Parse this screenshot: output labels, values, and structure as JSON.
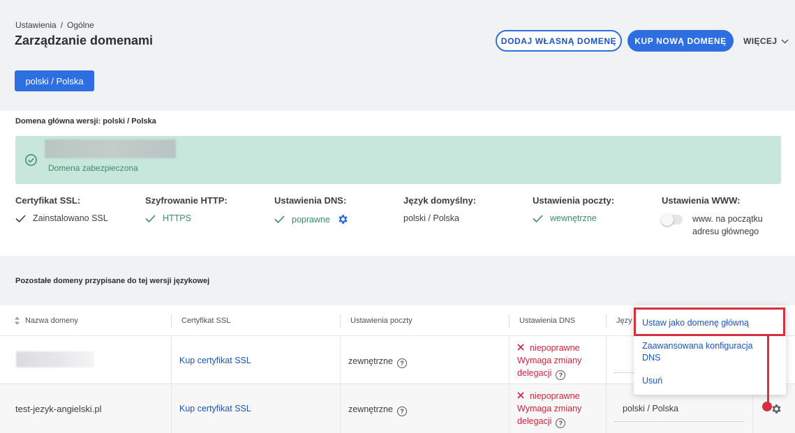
{
  "breadcrumb": {
    "parent": "Ustawienia",
    "separator": "/",
    "current": "Ogólne"
  },
  "page_title": "Zarządzanie domenami",
  "actions": {
    "add_own_domain": "DODAJ WŁASNĄ DOMENĘ",
    "buy_new_domain": "KUP NOWĄ DOMENĘ",
    "more": "WIĘCEJ"
  },
  "language_version_button": "polski / Polska",
  "main_domain": {
    "title": "Domena główna wersji: polski / Polska",
    "status": "Domena zabezpieczona",
    "columns": [
      {
        "label": "Certyfikat SSL:",
        "value": "Zainstalowano SSL"
      },
      {
        "label": "Szyfrowanie HTTP:",
        "value": "HTTPS"
      },
      {
        "label": "Ustawienia DNS:",
        "value": "poprawne"
      },
      {
        "label": "Język domyślny:",
        "value": "polski / Polska"
      },
      {
        "label": "Ustawienia poczty:",
        "value": "wewnętrzne"
      },
      {
        "label": "Ustawienia WWW:",
        "value_line1": "www. na początku",
        "value_line2": "adresu głównego"
      }
    ],
    "www_toggle_on": false
  },
  "other_domains": {
    "title": "Pozostałe domeny przypisane do tej wersji językowej",
    "headers": [
      "Nazwa domeny",
      "Certyfikat SSL",
      "Ustawienia poczty",
      "Ustawienia DNS",
      "Języ"
    ],
    "rows": [
      {
        "domain": "",
        "ssl": "Kup certyfikat SSL",
        "mail": "zewnętrzne",
        "dns_status": "niepoprawne",
        "dns_line2": "Wymaga zmiany",
        "dns_line3": "delegacji",
        "language": ""
      },
      {
        "domain": "test-jezyk-angielski.pl",
        "ssl": "Kup certyfikat SSL",
        "mail": "zewnętrzne",
        "dns_status": "niepoprawne",
        "dns_line2": "Wymaga zmiany",
        "dns_line3": "delegacji",
        "language": "polski / Polska"
      }
    ]
  },
  "context_menu": {
    "items": [
      "Ustaw jako domenę główną",
      "Zaawansowana konfiguracja",
      "DNS",
      "Usuń"
    ]
  },
  "colors": {
    "primary": "#2d6fe0",
    "success_bg": "#c7e6dc",
    "success_text": "#3e8a63",
    "error": "#d3203c",
    "highlight": "#d6303f"
  },
  "icons": [
    "check-circle-icon",
    "check-icon",
    "gear-icon",
    "help-circle-icon",
    "close-x-icon",
    "sort-icon",
    "chevron-down-icon"
  ]
}
